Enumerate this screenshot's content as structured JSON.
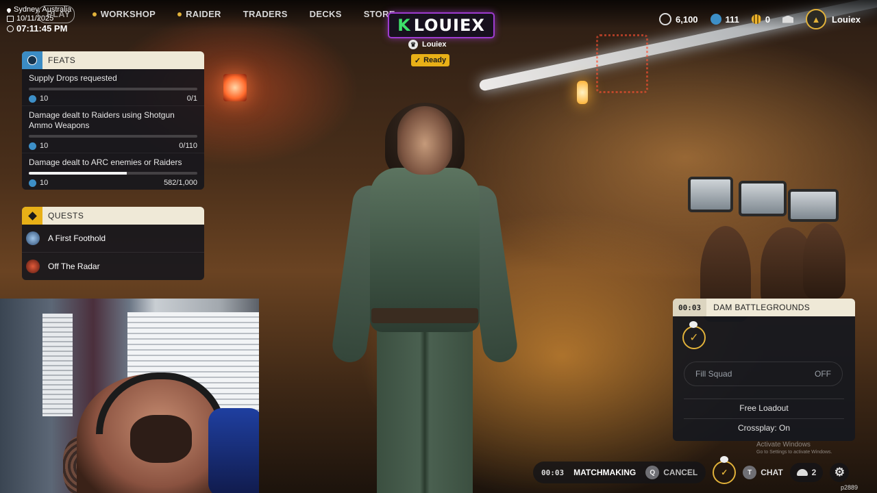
{
  "stream_overlay": {
    "location": "Sydney, Australia",
    "date": "10/11/2025",
    "time": "07:11:45 PM"
  },
  "nav": {
    "play": "PLAY",
    "workshop": "WORKSHOP",
    "raider": "RAIDER",
    "traders": "TRADERS",
    "decks": "DECKS",
    "store": "STORE"
  },
  "logo_text": {
    "k": "K",
    "rest": "LOUIEX"
  },
  "player": {
    "name": "Louiex",
    "status": "Ready"
  },
  "currencies": {
    "coins": "6,100",
    "tokens": "111",
    "credits": "0"
  },
  "account": {
    "username": "Louiex"
  },
  "feats": {
    "title": "FEATS",
    "items": [
      {
        "name": "Supply Drops requested",
        "reward": "10",
        "progress": "0/1",
        "fraction": 0.0
      },
      {
        "name": "Damage dealt to Raiders using Shotgun Ammo Weapons",
        "reward": "10",
        "progress": "0/110",
        "fraction": 0.0
      },
      {
        "name": "Damage dealt to ARC enemies or Raiders",
        "reward": "10",
        "progress": "582/1,000",
        "fraction": 0.582
      }
    ]
  },
  "quests": {
    "title": "QUESTS",
    "items": [
      {
        "name": "A First Foothold"
      },
      {
        "name": "Off The Radar"
      }
    ]
  },
  "matchmaking_card": {
    "timer": "00:03",
    "map": "DAM BATTLEGROUNDS",
    "fill_squad_label": "Fill Squad",
    "fill_squad_value": "OFF",
    "loadout": "Free Loadout",
    "crossplay": "Crossplay: On"
  },
  "windows_watermark": {
    "title": "Activate Windows",
    "sub": "Go to Settings to activate Windows."
  },
  "bottom_bar": {
    "timer": "00:03",
    "status": "MATCHMAKING",
    "cancel_key": "Q",
    "cancel": "CANCEL",
    "chat_key": "T",
    "chat": "CHAT",
    "party_count": "2"
  },
  "build": "p2889",
  "colors": {
    "accent_gold": "#e8b017",
    "feats_blue": "#3b8cc4",
    "panel_header": "#efe9d7"
  }
}
